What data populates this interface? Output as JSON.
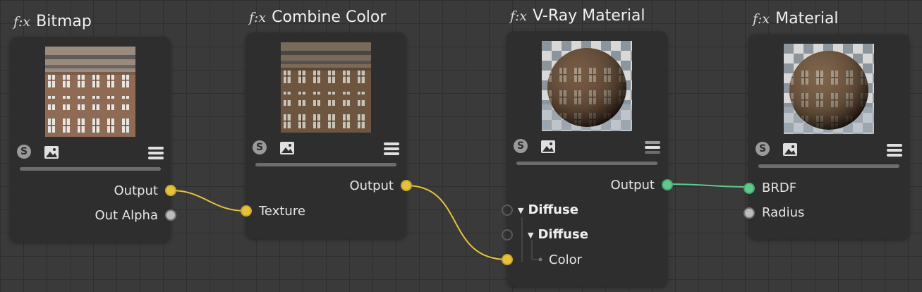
{
  "nodes": {
    "bitmap": {
      "title": "Bitmap",
      "fx": "f:x",
      "outputs": [
        "Output",
        "Out Alpha"
      ]
    },
    "combine": {
      "title": "Combine Color",
      "fx": "f:x",
      "input": "Texture",
      "output": "Output"
    },
    "vray": {
      "title": "V-Ray Material",
      "fx": "f:x",
      "output": "Output",
      "section1": "Diffuse",
      "section2": "Diffuse",
      "input": "Color"
    },
    "material": {
      "title": "Material",
      "fx": "f:x",
      "inputs": [
        "BRDF",
        "Radius"
      ]
    }
  },
  "icons": {
    "badge": "S",
    "image": "image-icon",
    "menu": "menu-icon"
  },
  "colors": {
    "yellow_wire": "#e5c23a",
    "green_wire": "#5fc98a",
    "node_bg": "#2e2e2e",
    "canvas_bg": "#3a3a3a"
  }
}
